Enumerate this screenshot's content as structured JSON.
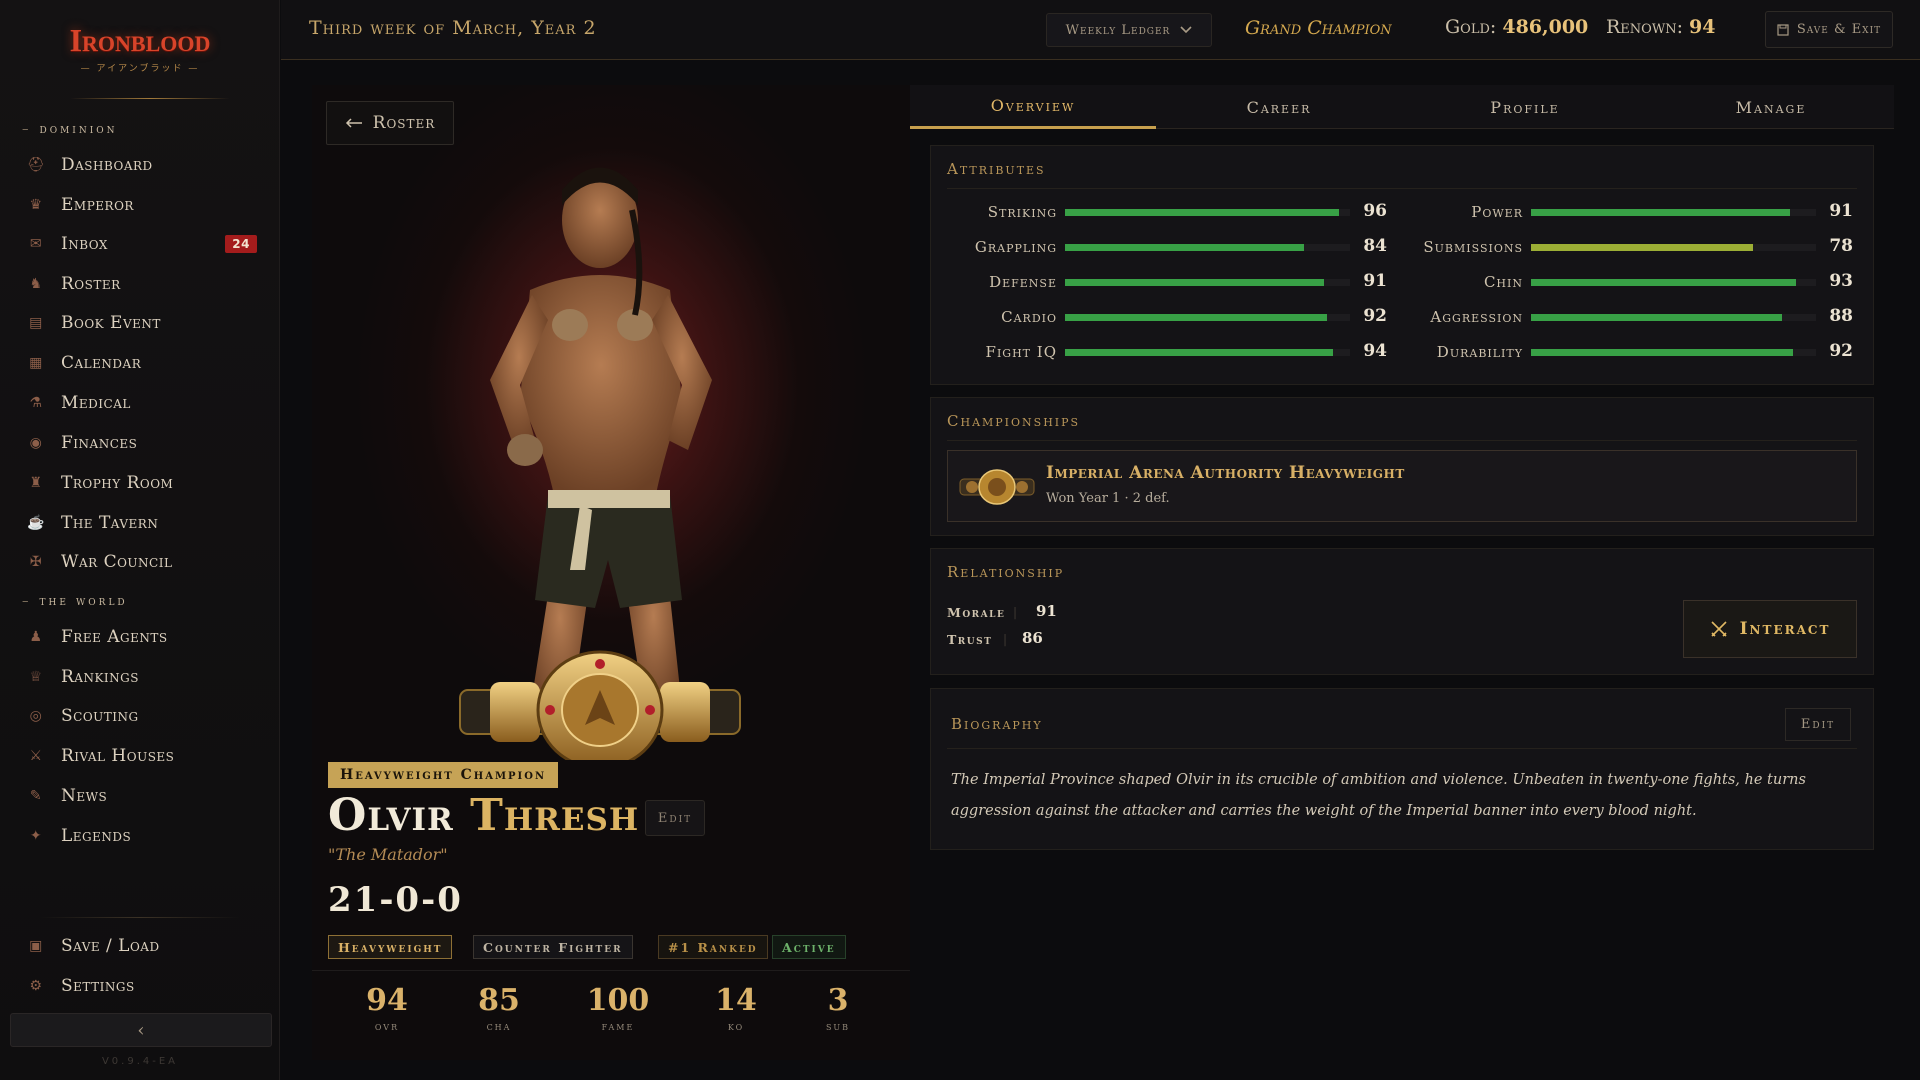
{
  "app": {
    "logo_title": "Ironblood",
    "logo_subtitle": "— アイアンブラッド —",
    "version": "V0.9.4-EA"
  },
  "sidebar": {
    "sections": [
      {
        "label": "dominion"
      },
      {
        "label": "the world"
      }
    ],
    "items": [
      {
        "label": "Dashboard",
        "icon": "helmet-icon"
      },
      {
        "label": "Emperor",
        "icon": "crown-icon"
      },
      {
        "label": "Inbox",
        "icon": "raven-icon",
        "badge": "24"
      },
      {
        "label": "Roster",
        "icon": "warrior-icon"
      },
      {
        "label": "Book Event",
        "icon": "scroll-icon"
      },
      {
        "label": "Calendar",
        "icon": "calendar-icon"
      },
      {
        "label": "Medical",
        "icon": "potion-icon"
      },
      {
        "label": "Finances",
        "icon": "coins-icon"
      },
      {
        "label": "Trophy Room",
        "icon": "trophy-icon"
      },
      {
        "label": "The Tavern",
        "icon": "tankard-icon"
      },
      {
        "label": "War Council",
        "icon": "map-icon"
      },
      {
        "label": "Free Agents",
        "icon": "fighter-icon"
      },
      {
        "label": "Rankings",
        "icon": "podium-icon"
      },
      {
        "label": "Scouting",
        "icon": "eye-icon"
      },
      {
        "label": "Rival Houses",
        "icon": "banner-icon"
      },
      {
        "label": "News",
        "icon": "quill-icon"
      },
      {
        "label": "Legends",
        "icon": "star-icon"
      },
      {
        "label": "Save / Load",
        "icon": "disk-icon"
      },
      {
        "label": "Settings",
        "icon": "gear-icon"
      }
    ],
    "collapse_label": "‹"
  },
  "topbar": {
    "date": "Third week of March, Year 2",
    "ledger_label": "Weekly Ledger",
    "rank_title": "Grand Champion",
    "gold_label": "Gold:",
    "gold_value": "486,000",
    "renown_label": "Renown:",
    "renown_value": "94",
    "save_exit_label": "Save & Exit"
  },
  "fighter": {
    "back_label": "Roster",
    "champion_tag": "Heavyweight Champion",
    "first_name": "Olvir",
    "last_name": "Thresh",
    "edit_label": "Edit",
    "nickname": "\"The Matador\"",
    "record": "21-0-0",
    "chips": [
      {
        "label": "Heavyweight",
        "color": "#d8b066"
      },
      {
        "label": "Counter Fighter",
        "color": "#bdb3a2"
      },
      {
        "label": "#1 Ranked",
        "color": "#b89048"
      },
      {
        "label": "Active",
        "color": "#6db26a"
      }
    ],
    "stats": [
      {
        "value": "94",
        "label": "ovr"
      },
      {
        "value": "85",
        "label": "cha"
      },
      {
        "value": "100",
        "label": "fame"
      },
      {
        "value": "14",
        "label": "ko"
      },
      {
        "value": "3",
        "label": "sub"
      }
    ]
  },
  "tabs": [
    {
      "label": "Overview",
      "active": true
    },
    {
      "label": "Career",
      "active": false
    },
    {
      "label": "Profile",
      "active": false
    },
    {
      "label": "Manage",
      "active": false
    }
  ],
  "attributes": {
    "title": "Attributes",
    "left": [
      {
        "label": "Striking",
        "value": 96
      },
      {
        "label": "Grappling",
        "value": 84
      },
      {
        "label": "Defense",
        "value": 91
      },
      {
        "label": "Cardio",
        "value": 92
      },
      {
        "label": "Fight IQ",
        "value": 94
      }
    ],
    "right": [
      {
        "label": "Power",
        "value": 91
      },
      {
        "label": "Submissions",
        "value": 78
      },
      {
        "label": "Chin",
        "value": 93
      },
      {
        "label": "Aggression",
        "value": 88
      },
      {
        "label": "Durability",
        "value": 92
      }
    ]
  },
  "championships": {
    "title": "Championships",
    "belt_title": "Imperial Arena Authority Heavyweight",
    "belt_sub": "Won Year 1 · 2 def."
  },
  "relationship": {
    "title": "Relationship",
    "morale_label": "Morale",
    "morale_value": "91",
    "trust_label": "Trust",
    "trust_value": "86",
    "interact_label": "Interact"
  },
  "biography": {
    "title": "Biography",
    "edit_label": "Edit",
    "text": "The Imperial Province shaped Olvir in its crucible of ambition and violence. Unbeaten in twenty-one fights, he turns aggression against the attacker and carries the weight of the Imperial banner into every blood night."
  },
  "colors": {
    "accent_gold": "#d8b066",
    "bar_green": "#38a146",
    "bar_yellow": "#9cae35",
    "badge_red": "#a41c1c"
  }
}
